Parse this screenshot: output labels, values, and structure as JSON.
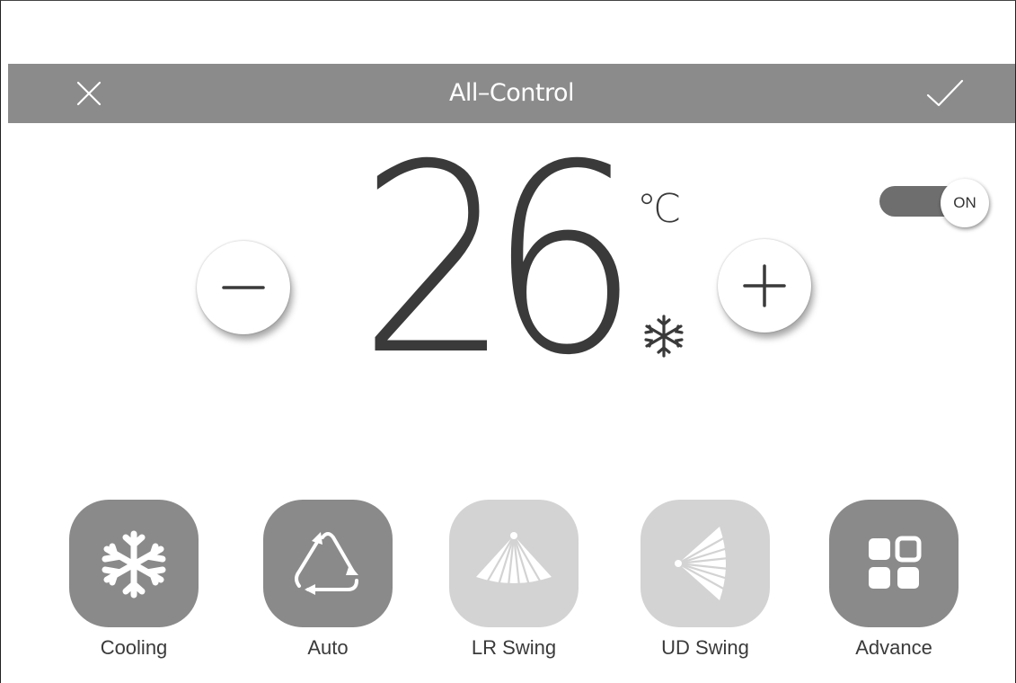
{
  "header": {
    "title": "All–Control",
    "close_icon": "close-icon",
    "confirm_icon": "check-icon",
    "background_color": "#8b8b8b"
  },
  "temperature": {
    "value": "26",
    "unit": "℃",
    "mode_indicator_icon": "snowflake-icon",
    "decrease_icon": "minus-icon",
    "increase_icon": "plus-icon"
  },
  "power": {
    "state_label": "ON",
    "is_on": true
  },
  "modes": [
    {
      "label": "Cooling",
      "icon": "snowflake-icon",
      "active": true
    },
    {
      "label": "Auto",
      "icon": "auto-cycle-icon",
      "active": true
    },
    {
      "label": "LR Swing",
      "icon": "lr-swing-fan-icon",
      "active": false
    },
    {
      "label": "UD Swing",
      "icon": "ud-swing-fan-icon",
      "active": false
    },
    {
      "label": "Advance",
      "icon": "grid-apps-icon",
      "active": true
    }
  ],
  "colors": {
    "active_tile": "#8a8a8a",
    "inactive_tile": "#d3d3d3",
    "text": "#3a3a3a"
  }
}
